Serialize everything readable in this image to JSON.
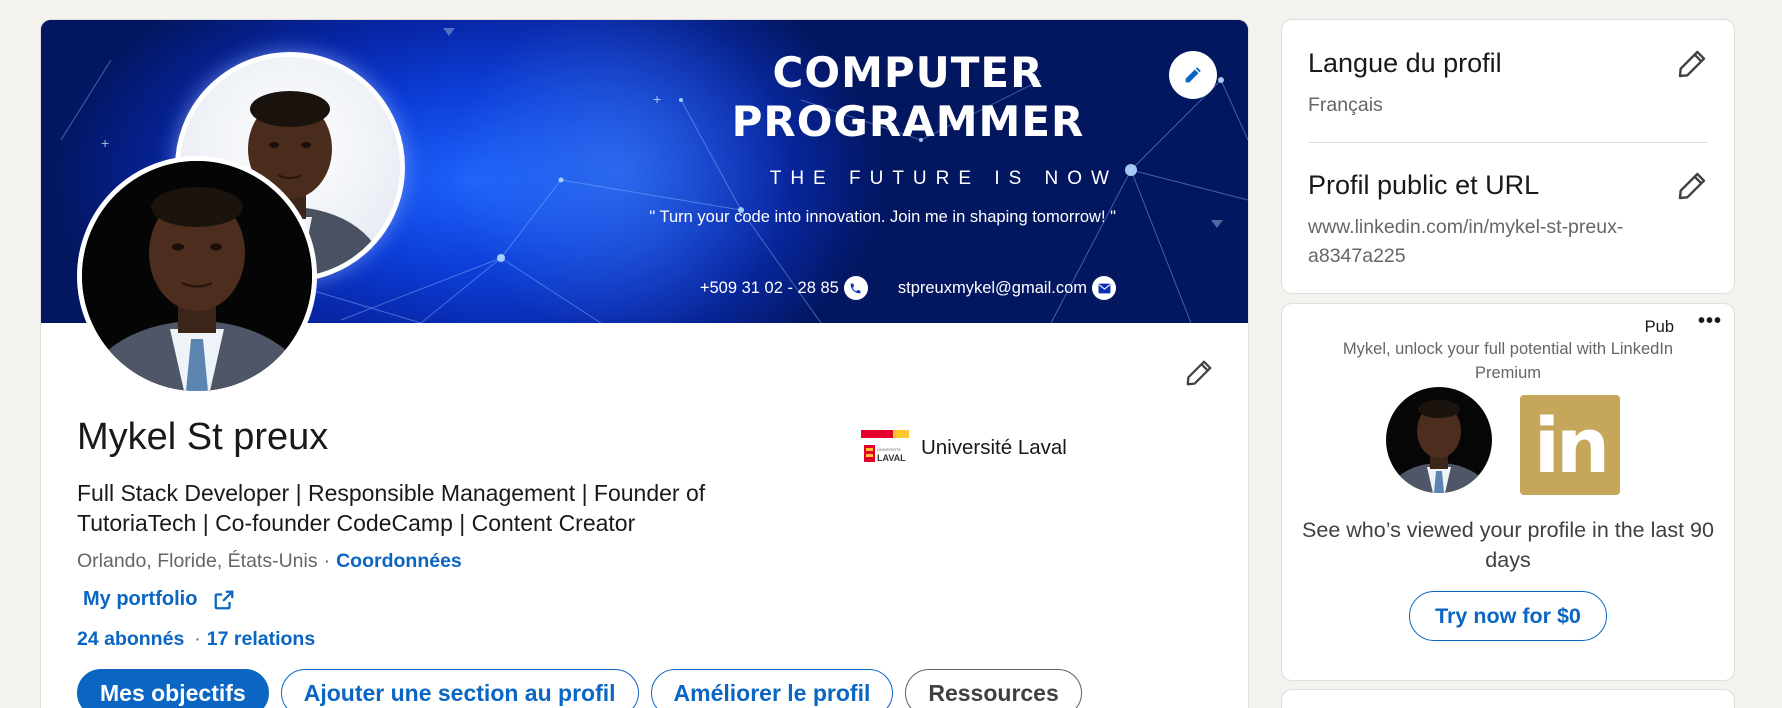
{
  "banner": {
    "title_line1": "COMPUTER",
    "title_line2": "PROGRAMMER",
    "tagline": "THE FUTURE IS NOW",
    "quote": "\" Turn your code into innovation. Join me in shaping tomorrow! \"",
    "phone": "+509 31 02 - 28 85",
    "email": "stpreuxmykel@gmail.com",
    "edit_icon": "pencil-icon"
  },
  "profile": {
    "name": "Mykel St preux",
    "headline": "Full Stack Developer | Responsible Management | Founder of TutoriaTech | Co-founder CodeCamp | Content Creator",
    "location": "Orlando, Floride, États-Unis",
    "location_sep": "·",
    "contact_link": "Coordonnées",
    "portfolio_link": "My portfolio",
    "followers": "24 abonnés",
    "network_sep": "·",
    "connections": "17 relations",
    "education": {
      "name": "Université Laval",
      "logo_text": "LAVAL",
      "logo_small_text": "UNIVERSITÉ"
    },
    "edit_icon": "pencil-icon"
  },
  "actions": {
    "primary": "Mes objectifs",
    "add_section": "Ajouter une section au profil",
    "improve": "Améliorer le profil",
    "resources": "Ressources"
  },
  "sidebar": {
    "language": {
      "title": "Langue du profil",
      "value": "Français"
    },
    "public_profile": {
      "title": "Profil public et URL",
      "value": "www.linkedin.com/in/mykel-st-preux-a8347a225"
    }
  },
  "promo": {
    "pub_label": "Pub",
    "more": "•••",
    "text": "Mykel, unlock your full potential with LinkedIn Premium",
    "logo_text": "in",
    "body": "See who’s viewed your profile in the last 90 days",
    "button": "Try now for $0"
  },
  "colors": {
    "accent": "#0a66c2",
    "banner_blue": "#0726a8",
    "premium_gold": "#c5a65a",
    "page_bg": "#f3f2ef"
  }
}
